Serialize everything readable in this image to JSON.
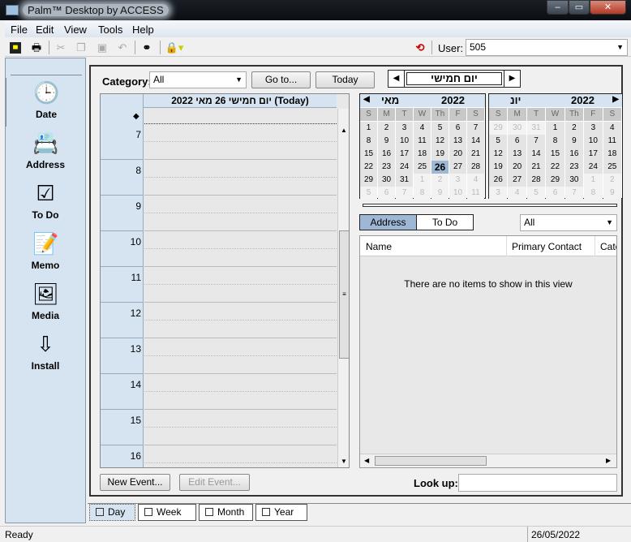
{
  "window": {
    "title": "Palm™ Desktop by ACCESS",
    "controls": [
      "minimize",
      "maximize",
      "close"
    ]
  },
  "menu": [
    "File",
    "Edit",
    "View",
    "Tools",
    "Help"
  ],
  "toolbar": {
    "icons": [
      "save-icon",
      "print-icon",
      "cut-icon",
      "copy-icon",
      "paste-icon",
      "undo-icon",
      "find-icon",
      "lock-icon"
    ],
    "user_label": "User:",
    "user_value": "505"
  },
  "sidebar": {
    "items": [
      {
        "label": "Date",
        "icon": "date-icon",
        "active": true
      },
      {
        "label": "Address",
        "icon": "address-icon"
      },
      {
        "label": "To Do",
        "icon": "todo-icon"
      },
      {
        "label": "Memo",
        "icon": "memo-icon"
      },
      {
        "label": "Media",
        "icon": "media-icon"
      },
      {
        "label": "Install",
        "icon": "install-icon"
      }
    ]
  },
  "main": {
    "category_label": "Category:",
    "category_value": "All",
    "goto_label": "Go to...",
    "today_label": "Today",
    "day_name": "יום חמישי",
    "day_header": "יום חמישי 26 מאי 2022 (Today)",
    "untimed_marker": "◆",
    "hours": [
      "7",
      "8",
      "9",
      "10",
      "11",
      "12",
      "13",
      "14",
      "15",
      "16"
    ],
    "new_event": "New Event...",
    "edit_event": "Edit Event...",
    "lookup_label": "Look up:"
  },
  "calendars": [
    {
      "month": "מאי",
      "year": "2022",
      "nav": "◀",
      "weekdays": [
        "S",
        "M",
        "T",
        "W",
        "Th",
        "F",
        "S"
      ],
      "days": [
        [
          "1",
          "2",
          "3",
          "4",
          "5",
          "6",
          "7"
        ],
        [
          "8",
          "9",
          "10",
          "11",
          "12",
          "13",
          "14"
        ],
        [
          "15",
          "16",
          "17",
          "18",
          "19",
          "20",
          "21"
        ],
        [
          "22",
          "23",
          "24",
          "25",
          "26",
          "27",
          "28"
        ],
        [
          "29",
          "30",
          "31",
          "1",
          "2",
          "3",
          "4"
        ],
        [
          "5",
          "6",
          "7",
          "8",
          "9",
          "10",
          "11"
        ]
      ],
      "selected": "26",
      "first_day_index": 0,
      "current_month_days": 31
    },
    {
      "month": "יונ",
      "year": "2022",
      "nav": "▶",
      "weekdays": [
        "S",
        "M",
        "T",
        "W",
        "Th",
        "F",
        "S"
      ],
      "days": [
        [
          "29",
          "30",
          "31",
          "1",
          "2",
          "3",
          "4"
        ],
        [
          "5",
          "6",
          "7",
          "8",
          "9",
          "10",
          "11"
        ],
        [
          "12",
          "13",
          "14",
          "15",
          "16",
          "17",
          "18"
        ],
        [
          "19",
          "20",
          "21",
          "22",
          "23",
          "24",
          "25"
        ],
        [
          "26",
          "27",
          "28",
          "29",
          "30",
          "1",
          "2"
        ],
        [
          "3",
          "4",
          "5",
          "6",
          "7",
          "8",
          "9"
        ]
      ],
      "first_day_index": 3,
      "current_month_days": 30
    }
  ],
  "list": {
    "tabs": [
      "Address",
      "To Do"
    ],
    "active_tab": "Address",
    "filter": "All",
    "columns": [
      "Name",
      "Primary Contact",
      "Cate"
    ],
    "empty_message": "There are no items to show in this view"
  },
  "view_tabs": [
    "Day",
    "Week",
    "Month",
    "Year"
  ],
  "active_view": "Day",
  "status": {
    "text": "Ready",
    "date": "26/05/2022"
  },
  "colors": {
    "accent": "#d6e4f2",
    "selected_day": "#9db7d4",
    "active_tab": "#9db7d4"
  }
}
